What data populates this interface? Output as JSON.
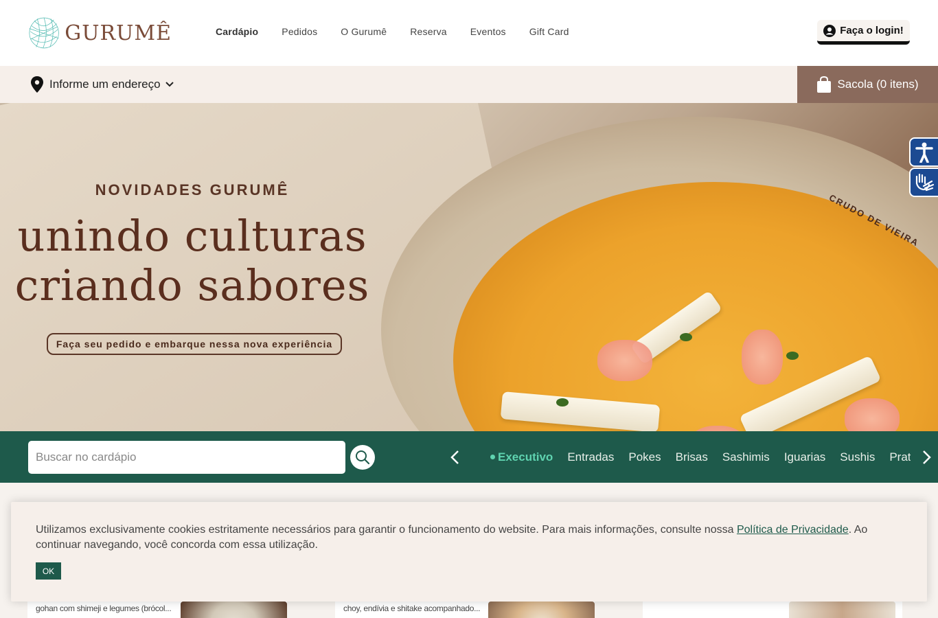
{
  "brand": {
    "name": "GURUMÊ"
  },
  "nav": {
    "items": [
      {
        "label": "Cardápio",
        "active": true
      },
      {
        "label": "Pedidos"
      },
      {
        "label": "O Gurumê"
      },
      {
        "label": "Reserva"
      },
      {
        "label": "Eventos"
      },
      {
        "label": "Gift Card"
      }
    ]
  },
  "login": {
    "label": "Faça o login!",
    "icon": "user-circle-icon"
  },
  "address": {
    "label": "Informe um endereço",
    "icon": "map-pin-icon"
  },
  "bag": {
    "label": "Sacola (0 itens)",
    "icon": "shopping-bag-icon"
  },
  "hero": {
    "kicker": "NOVIDADES GURUMÊ",
    "title_line1": "unindo culturas",
    "title_line2": "criando sabores",
    "cta": "Faça seu pedido e embarque nessa nova experiência",
    "dish_tag": "CRUDO DE VIEIRA"
  },
  "search": {
    "placeholder": "Buscar no cardápio",
    "icon": "search-icon"
  },
  "categories": {
    "items": [
      "Executivo",
      "Entradas",
      "Pokes",
      "Brisas",
      "Sashimis",
      "Iguarias",
      "Sushis",
      "Pratos"
    ],
    "active": "Executivo"
  },
  "products": [
    {
      "desc": "gohan com shimeji e legumes (brócol..."
    },
    {
      "desc": "choy, endívia e shitake acompanhado..."
    },
    {
      "desc": ""
    }
  ],
  "cookie": {
    "text_before": "Utilizamos exclusivamente cookies estritamente necessários para garantir o funcionamento do website. Para mais informações, consulte nossa ",
    "link": "Política de Privacidade",
    "text_after": ". Ao continuar navegando, você concorda com essa utilização.",
    "ok": "OK"
  },
  "colors": {
    "primary_green": "#1e5a4b",
    "accent_mint": "#5fd3b0",
    "brown": "#5a2e1e",
    "bag_bg": "#8a6a5c",
    "a11y_blue": "#1c4a92"
  }
}
